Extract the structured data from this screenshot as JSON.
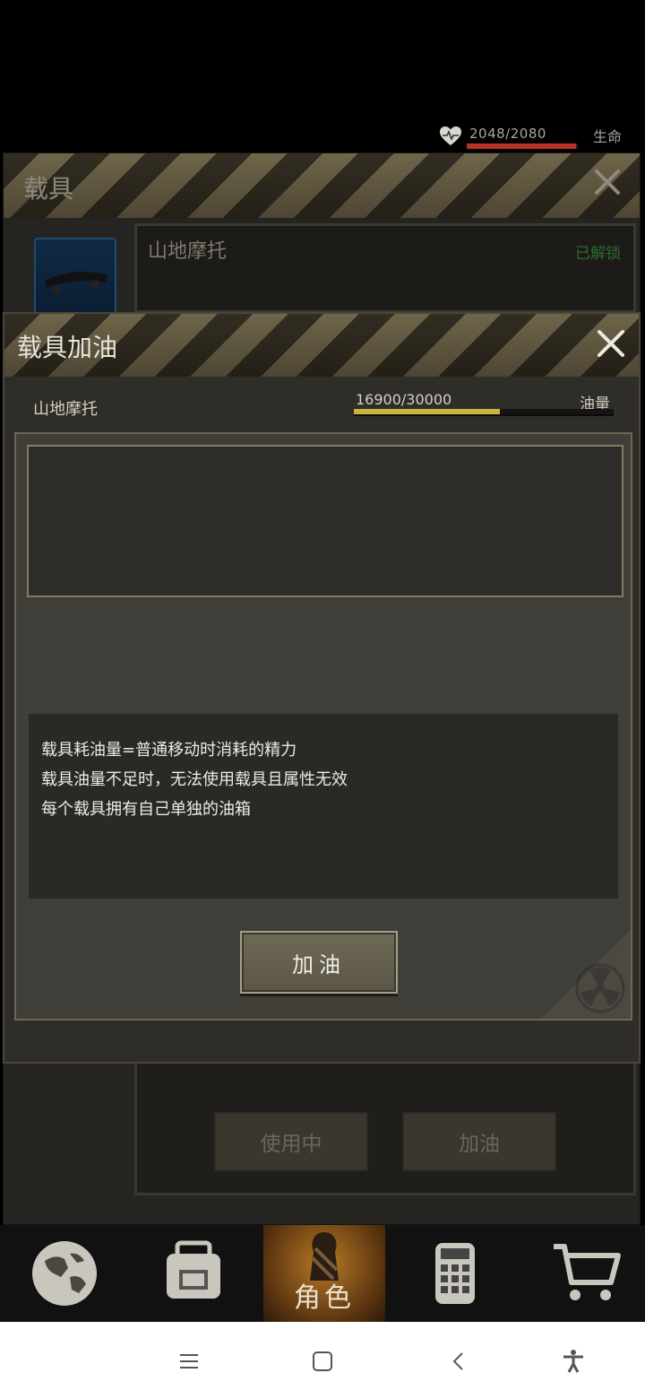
{
  "status": {
    "hp_value": "2048/2080",
    "hp_fraction": 0.985,
    "hp_label": "生命"
  },
  "vehicle_panel": {
    "title": "载具",
    "vehicle_name": "山地摩托",
    "unlock_status": "已解锁",
    "in_use_label": "使用中",
    "refuel_label": "加油"
  },
  "refuel_dialog": {
    "title": "载具加油",
    "vehicle_name": "山地摩托",
    "fuel_value": "16900/30000",
    "fuel_fraction": 0.5633,
    "fuel_label": "油量",
    "info_lines": [
      "载具耗油量=普通移动时消耗的精力",
      "载具油量不足时，无法使用载具且属性无效",
      "每个载具拥有自己单独的油箱"
    ],
    "refuel_button": "加油"
  },
  "bottom_nav": {
    "active_label": "角色"
  },
  "colors": {
    "fuel_fill": "#c8b638",
    "hp_fill": "#b83226",
    "unlocked": "#2b6b2b"
  }
}
